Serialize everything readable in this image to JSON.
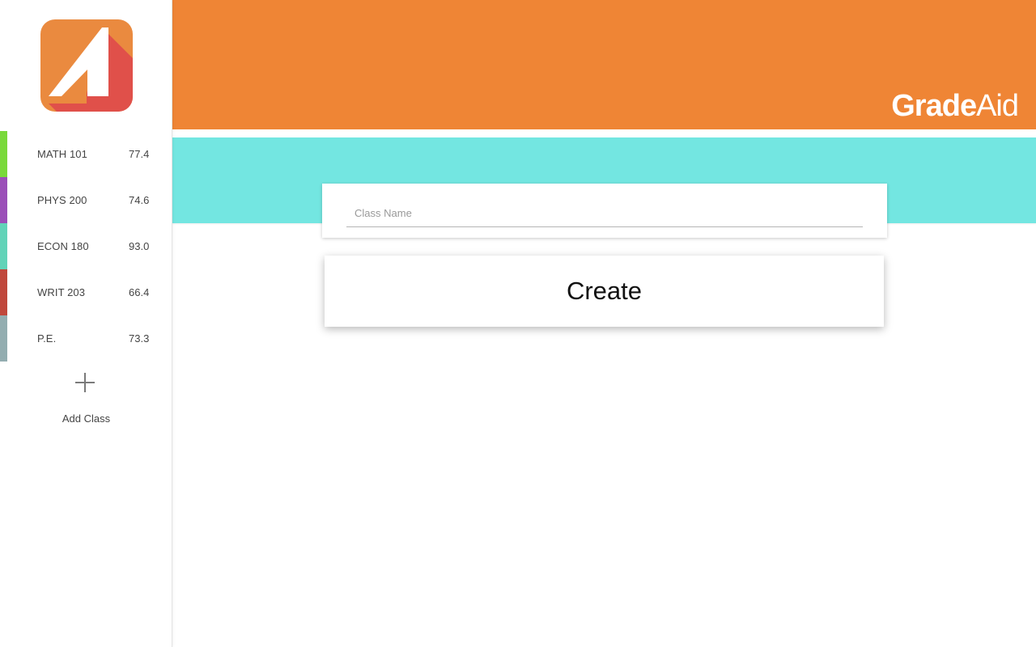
{
  "app": {
    "brand_bold": "Grade",
    "brand_light": "Aid"
  },
  "colors": {
    "header": "#ef8535",
    "band": "#73e6e1",
    "logo_bg": "#ea8a3f",
    "logo_red": "#e0504a"
  },
  "sidebar": {
    "classes": [
      {
        "name": "MATH 101",
        "grade": "77.4",
        "color": "#79d93a"
      },
      {
        "name": "PHYS 200",
        "grade": "74.6",
        "color": "#9b4fb8"
      },
      {
        "name": "ECON 180",
        "grade": "93.0",
        "color": "#62d3b8"
      },
      {
        "name": "WRIT 203",
        "grade": "66.4",
        "color": "#c0473b"
      },
      {
        "name": "P.E.",
        "grade": "73.3",
        "color": "#93adb0"
      }
    ],
    "add_class_label": "Add Class",
    "add_icon": "plus-icon"
  },
  "form": {
    "class_name_placeholder": "Class Name",
    "class_name_value": "",
    "create_label": "Create"
  }
}
